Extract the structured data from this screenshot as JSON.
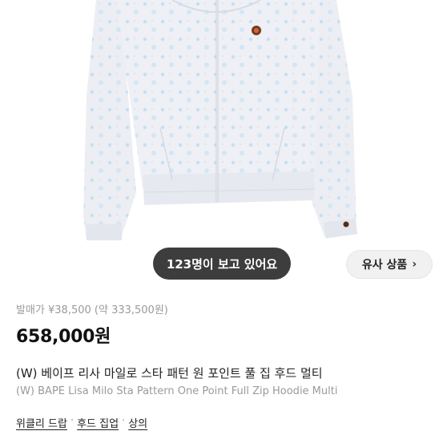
{
  "viewer_badge": "123명이 보고 있어요",
  "similar_button": "유사 상품",
  "release_price": "발매가 ¥38,500 (약 333,500원)",
  "price": "658,000원",
  "title_ko": "(W) 베이프 리사 마일로 스타 패턴 원 포인트 풀 집 후드 멀티",
  "title_en": "(W) BAPE Lisa Milo Sta Pattern One Point Full Zip Hoodie Multi",
  "categories": [
    "위클리 드랍",
    "후드 집업",
    "상의"
  ],
  "category_separator": "·",
  "icons": {
    "chevron": "chevron-right-icon"
  },
  "colors": {
    "hoodie": "#e9ebf2",
    "pattern": "#bcd9ee",
    "pill_bg": "#222222"
  }
}
